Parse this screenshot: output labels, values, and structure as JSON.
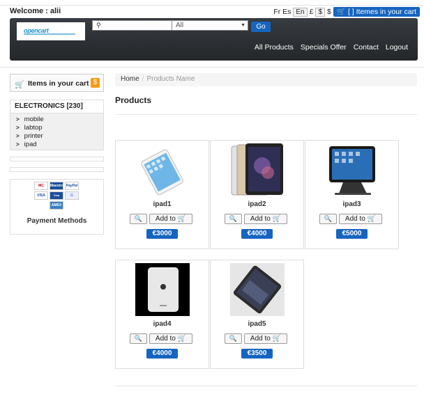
{
  "header": {
    "welcome": "Welcome : alii",
    "lang_fr_es": "Fr Es",
    "lang_en": "En",
    "currency_pound": "£",
    "currency_dollar_box": "$",
    "currency_dollar": "$",
    "cart_button": "[ ] Itemes in your cart",
    "logo_text": "opencart",
    "search_placeholder": "",
    "category_select": "All",
    "go_label": "Go",
    "nav": [
      "All Products",
      "Specials Offer",
      "Contact",
      "Logout"
    ]
  },
  "sidebar": {
    "cart_label": "Items in your cart",
    "cart_badge": "$",
    "category_title": "ELECTRONICS [230]",
    "categories": [
      "mobile",
      "labtop",
      "printer",
      "ipad"
    ],
    "payment_label": "Payment Methods",
    "cards": [
      "MC",
      "Maestro",
      "PayPal",
      "VISA",
      "Visa Electron",
      "G",
      "AMEX"
    ]
  },
  "breadcrumb": {
    "home": "Home",
    "current": "Products Name"
  },
  "page_title": "Products",
  "products": [
    {
      "name": "ipad1",
      "add_label": "Add to",
      "price": "€3000"
    },
    {
      "name": "ipad2",
      "add_label": "Add to",
      "price": "€4000"
    },
    {
      "name": "ipad3",
      "add_label": "Add to",
      "price": "€5000"
    },
    {
      "name": "ipad4",
      "add_label": "Add to",
      "price": "€4000"
    },
    {
      "name": "ipad5",
      "add_label": "Add to",
      "price": "€3500"
    }
  ],
  "colors": {
    "accent": "#1565c0",
    "header_bg": "#2f3337",
    "badge_orange": "#f39c12"
  }
}
